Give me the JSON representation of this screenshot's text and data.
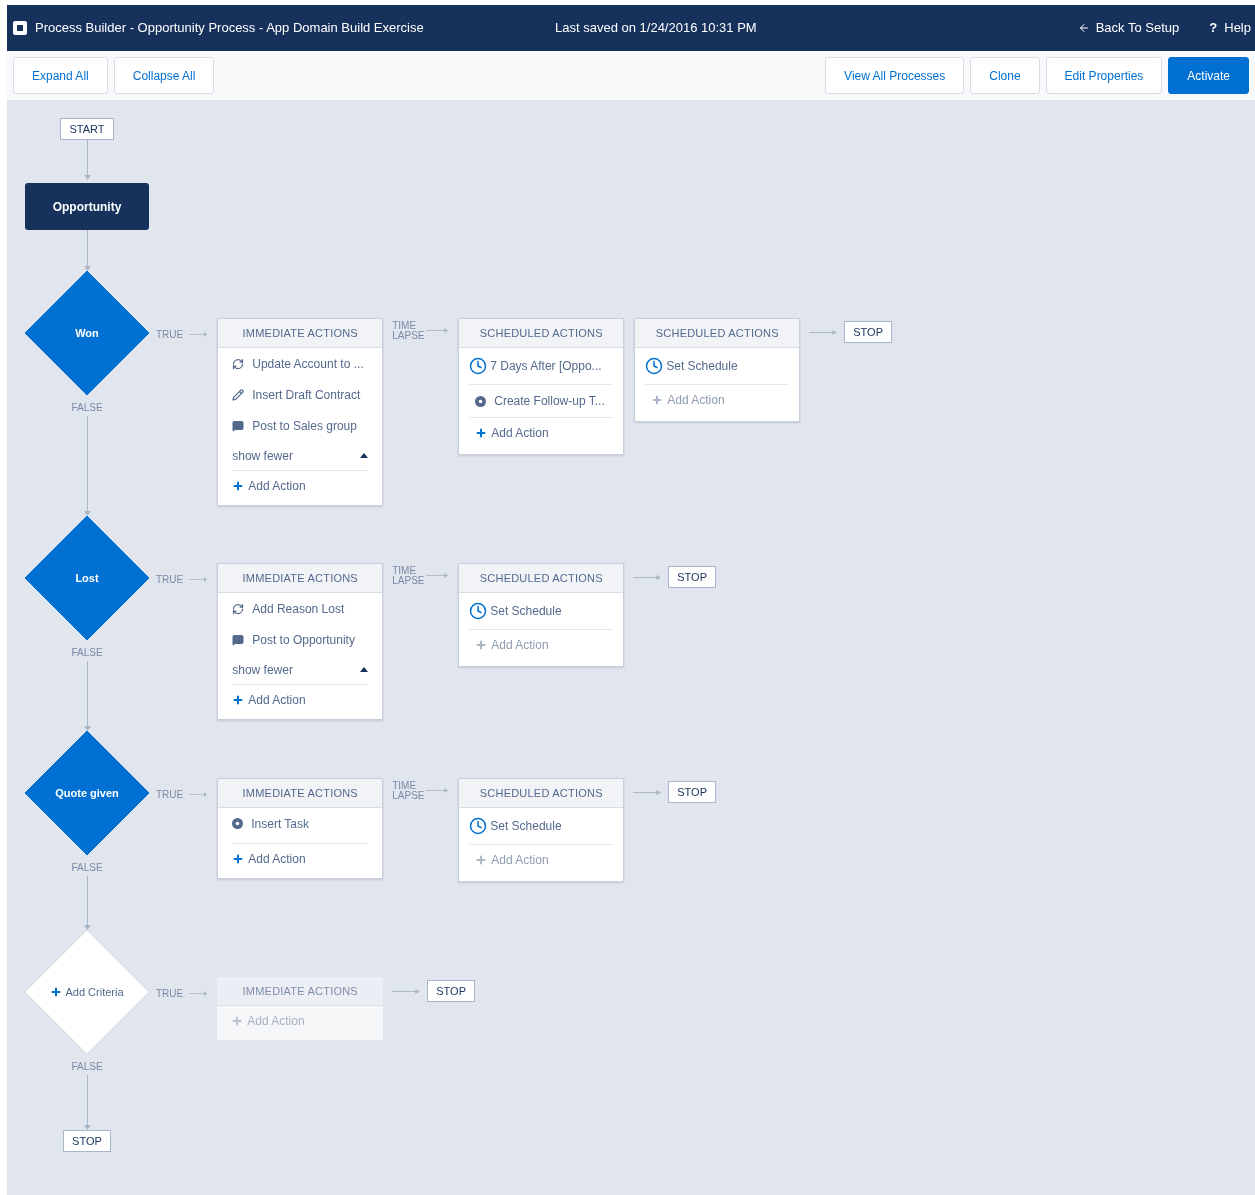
{
  "header": {
    "title": "Process Builder - Opportunity Process - App Domain Build Exercise",
    "saved": "Last saved on 1/24/2016 10:31 PM",
    "back": "Back To Setup",
    "help_glyph": "?",
    "help": "Help"
  },
  "toolbar": {
    "left": [
      {
        "label": "Expand All",
        "primary": false
      },
      {
        "label": "Collapse All",
        "primary": false
      }
    ],
    "right": [
      {
        "label": "View All Processes",
        "primary": false
      },
      {
        "label": "Clone",
        "primary": false
      },
      {
        "label": "Edit Properties",
        "primary": false
      },
      {
        "label": "Activate",
        "primary": true
      }
    ]
  },
  "canvas": {
    "start": "START",
    "object": "Opportunity",
    "criteria": [
      {
        "kind": "criteria",
        "label": "Won",
        "true_label": "TRUE",
        "false_label": "FALSE",
        "immediate": {
          "title": "IMMEDIATE ACTIONS",
          "actions": [
            {
              "kind": "update",
              "label": "Update Account to ..."
            },
            {
              "kind": "edit",
              "label": "Insert Draft Contract"
            },
            {
              "kind": "post",
              "label": "Post to Sales group"
            }
          ],
          "toggle": "show fewer",
          "add": "Add Action",
          "add_disabled": false
        },
        "time_lapse": "TIME LAPSE",
        "scheduled": [
          {
            "title": "SCHEDULED ACTIONS",
            "schedule": "7 Days After [Oppo...",
            "actions": [
              {
                "kind": "task",
                "label": "Create Follow-up T..."
              }
            ],
            "add": "Add Action",
            "add_disabled": false
          },
          {
            "title": "SCHEDULED ACTIONS",
            "schedule": "Set Schedule",
            "add": "Add Action",
            "add_disabled": true
          }
        ],
        "stop": "STOP"
      },
      {
        "kind": "criteria",
        "label": "Lost",
        "true_label": "TRUE",
        "false_label": "FALSE",
        "immediate": {
          "title": "IMMEDIATE ACTIONS",
          "actions": [
            {
              "kind": "update",
              "label": "Add Reason Lost"
            },
            {
              "kind": "post",
              "label": "Post to Opportunity"
            }
          ],
          "toggle": "show fewer",
          "add": "Add Action",
          "add_disabled": false
        },
        "time_lapse": "TIME LAPSE",
        "scheduled": [
          {
            "title": "SCHEDULED ACTIONS",
            "schedule": "Set Schedule",
            "add": "Add Action",
            "add_disabled": true
          }
        ],
        "stop": "STOP"
      },
      {
        "kind": "criteria",
        "label": "Quote given",
        "true_label": "TRUE",
        "false_label": "FALSE",
        "immediate": {
          "title": "IMMEDIATE ACTIONS",
          "actions": [
            {
              "kind": "task",
              "label": "Insert Task"
            }
          ],
          "add": "Add Action",
          "add_disabled": false
        },
        "time_lapse": "TIME LAPSE",
        "scheduled": [
          {
            "title": "SCHEDULED ACTIONS",
            "schedule": "Set Schedule",
            "add": "Add Action",
            "add_disabled": true
          }
        ],
        "stop": "STOP"
      },
      {
        "kind": "placeholder",
        "label": "Add Criteria",
        "true_label": "TRUE",
        "false_label": "FALSE",
        "immediate": {
          "title": "IMMEDIATE ACTIONS",
          "add": "Add Action",
          "add_disabled": true
        },
        "stop": "STOP"
      }
    ],
    "end_stop": "STOP"
  }
}
